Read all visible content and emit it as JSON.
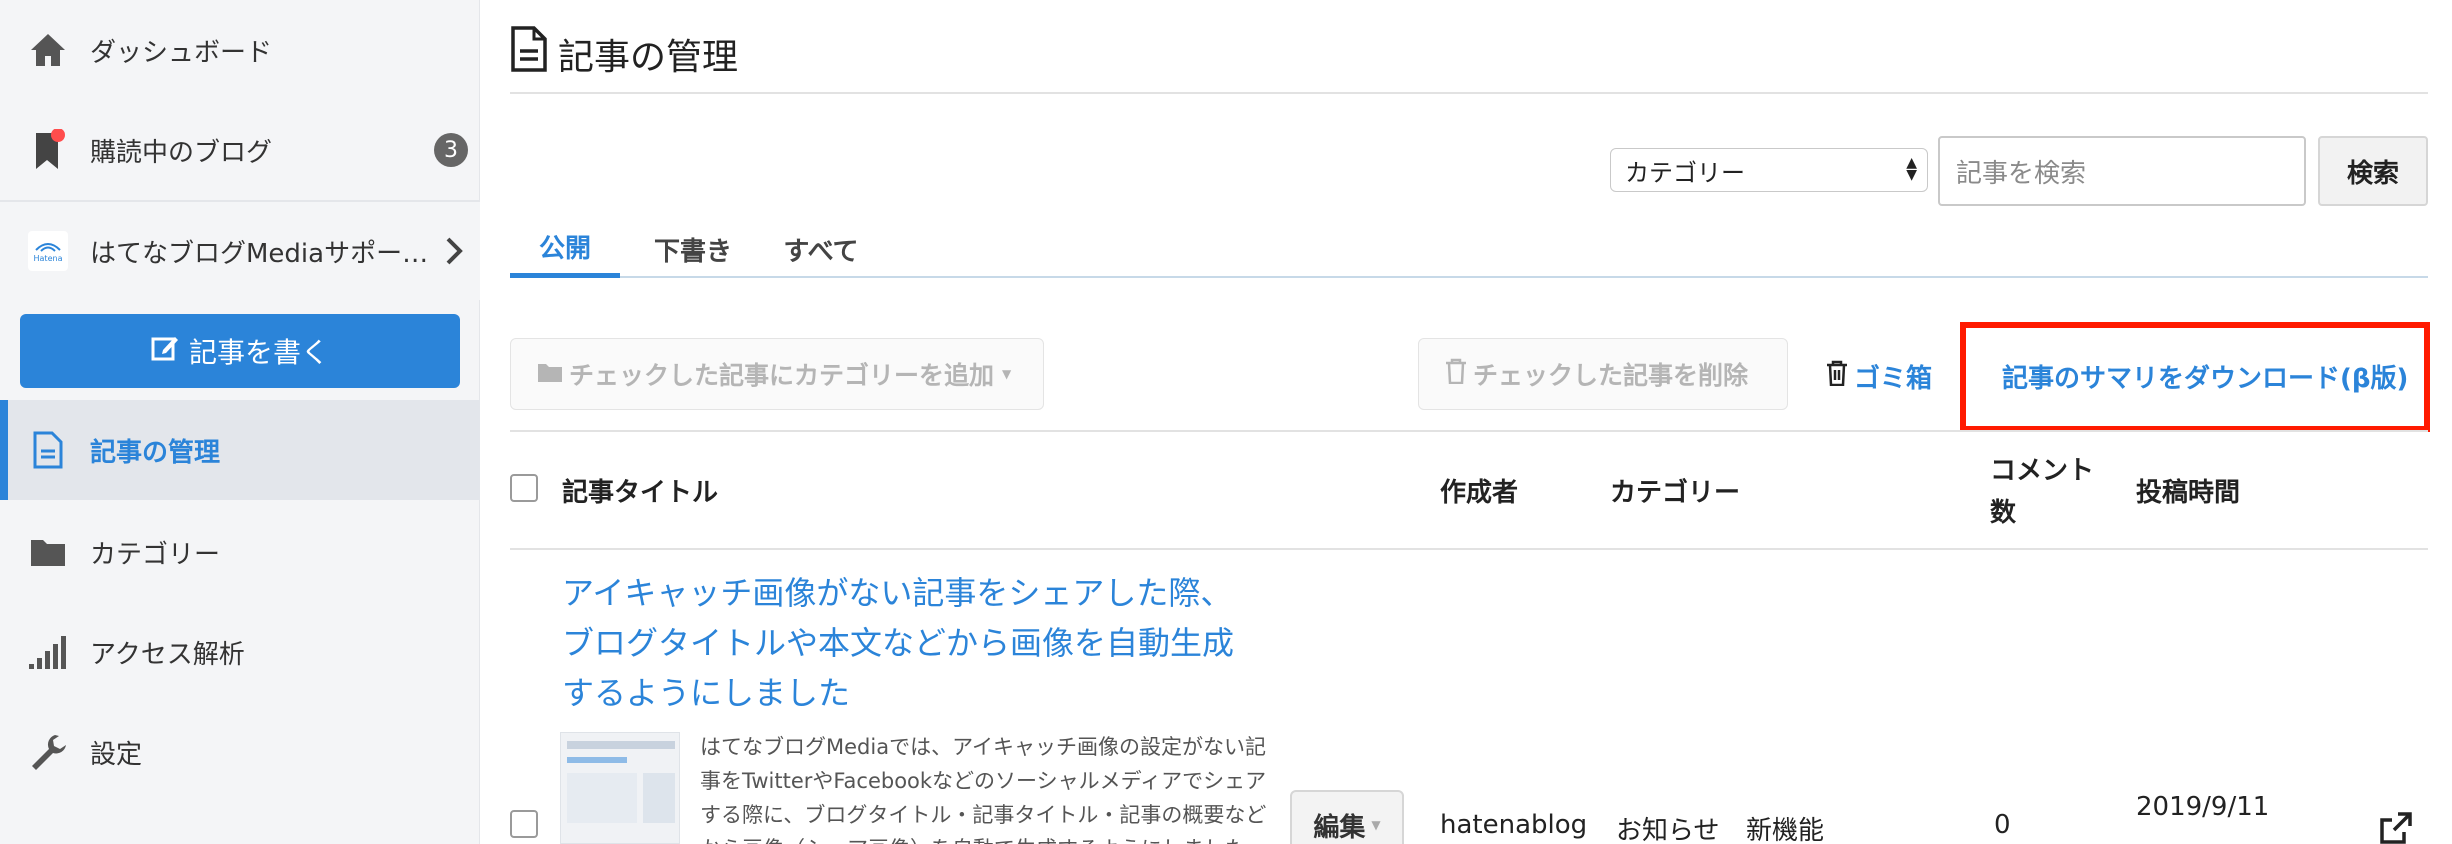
{
  "sidebar": {
    "dashboard": "ダッシュボード",
    "subscriptions": "購読中のブログ",
    "subscriptions_count": "3",
    "blog_name": "はてなブログMediaサポー…",
    "logo_text": "Hatena",
    "write_button": "記事を書く",
    "manage": "記事の管理",
    "category": "カテゴリー",
    "analytics": "アクセス解析",
    "settings": "設定"
  },
  "main": {
    "page_title": "記事の管理",
    "category_select": "カテゴリー",
    "search_placeholder": "記事を検索",
    "search_button": "検索",
    "tabs": [
      "公開",
      "下書き",
      "すべて"
    ],
    "add_category_button": "チェックした記事にカテゴリーを追加",
    "delete_button": "チェックした記事を削除",
    "trash_link": "ゴミ箱",
    "download_link": "記事のサマリをダウンロード(β版)"
  },
  "table": {
    "headers": {
      "title": "記事タイトル",
      "author": "作成者",
      "category": "カテゴリー",
      "comments": "コメント数",
      "posted": "投稿時間"
    },
    "rows": [
      {
        "title": "アイキャッチ画像がない記事をシェアした際、ブログタイトルや本文などから画像を自動生成するようにしました",
        "summary": "はてなブログMediaでは、アイキャッチ画像の設定がない記事をTwitterやFacebookなどのソーシャルメディアでシェアする際に、ブログタイトル・記事タイトル・記事の概要などから画像（シェア画像）を自動で生成するようにしました",
        "edit_button": "編集",
        "author": "hatenablog",
        "categories": [
          "お知らせ",
          "新機能"
        ],
        "comments": "0",
        "posted": "2019/9/11"
      }
    ]
  },
  "colors": {
    "accent": "#2b84d9",
    "highlight": "#ff1a00",
    "sidebar_bg": "#f4f5f7"
  }
}
